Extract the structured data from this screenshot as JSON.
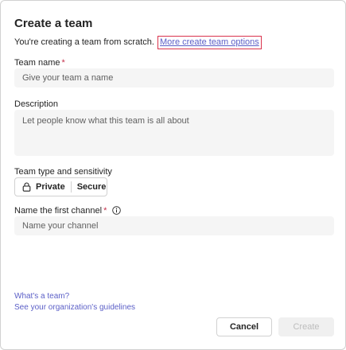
{
  "dialog": {
    "title": "Create a team",
    "subtitle": "You're creating a team from scratch.",
    "more_options_link": "More create team options"
  },
  "team_name": {
    "label": "Team name",
    "required_mark": "*",
    "placeholder": "Give your team a name"
  },
  "description": {
    "label": "Description",
    "placeholder": "Let people know what this team is all about"
  },
  "team_type": {
    "label": "Team type and sensitivity",
    "privacy": "Private",
    "sensitivity": "Secure",
    "icon": "lock-icon"
  },
  "channel": {
    "label": "Name the first channel",
    "required_mark": "*",
    "info_icon": "info-icon",
    "placeholder": "Name your channel"
  },
  "footer": {
    "whats_a_team_link": "What's a team?",
    "guidelines_link": "See your organization's guidelines",
    "cancel_label": "Cancel",
    "create_label": "Create"
  },
  "colors": {
    "link": "#5b5fc7",
    "highlight_border": "#d9334d",
    "required": "#c4314b",
    "field_bg": "#f5f5f5"
  }
}
